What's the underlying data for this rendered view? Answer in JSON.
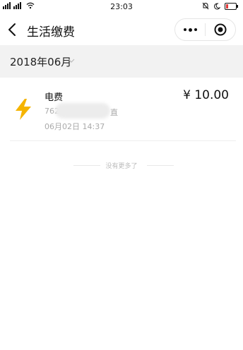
{
  "status_bar": {
    "left_text": "ᴇᴍ̶6̵5ˡˡ",
    "time": "23:03"
  },
  "navbar": {
    "title": "生活缴费",
    "back_icon": "chevron-left-icon",
    "more_icon": "more-dots-icon",
    "close_icon": "target-close-icon"
  },
  "filter": {
    "month": "2018年06月",
    "chevron_icon": "chevron-down-icon"
  },
  "records": [
    {
      "icon": "lightning-icon",
      "icon_color": "#f5b400",
      "name": "电费",
      "amount": "¥ 10.00",
      "account_prefix": "762",
      "account_suffix": "直",
      "time": "06月02日  14:37"
    }
  ],
  "footer": {
    "no_more": "没有更多了"
  },
  "colors": {
    "accent": "#f5b400",
    "month_bar_bg": "#f2f2f2",
    "muted_text": "#aaaaaa"
  }
}
